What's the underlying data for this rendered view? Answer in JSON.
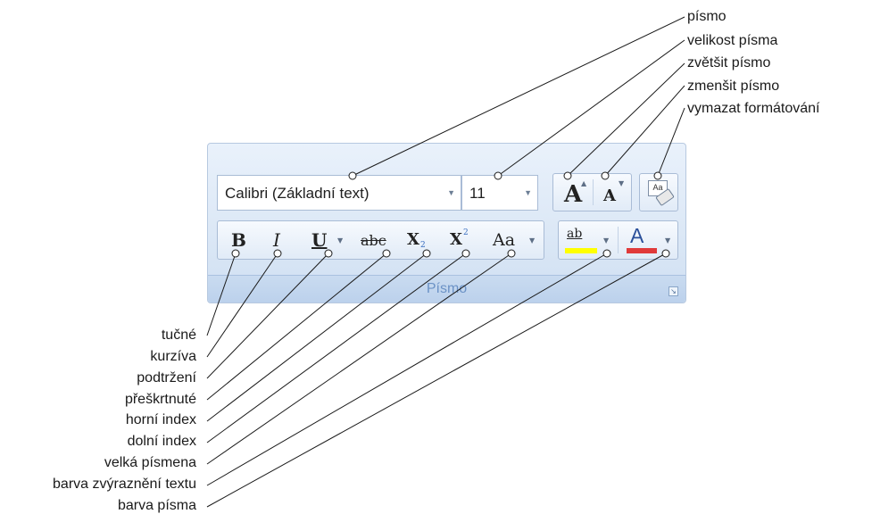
{
  "ribbon": {
    "group_title": "Písmo",
    "font_name": "Calibri (Základní text)",
    "font_size": "11",
    "icons": {
      "bold": "B",
      "italic": "I",
      "underline": "U",
      "strike": "abc",
      "subscript": "X",
      "superscript": "X",
      "change_case": "Aa",
      "grow": "A",
      "shrink": "A",
      "clear": "Aa",
      "font_color": "A",
      "highlight": "ab"
    },
    "colors": {
      "highlight": "#ffff00",
      "font_color": "#e03a3a",
      "group_title": "#6b92c6"
    }
  },
  "labels_top": [
    "písmo",
    "velikost písma",
    "zvětšit písmo",
    "zmenšit písmo",
    "vymazat formátování"
  ],
  "labels_left": [
    "tučné",
    "kurzíva",
    "podtržení",
    "přeškrtnuté",
    "horní index",
    "dolní index",
    "velká písmena",
    "barva zvýraznění textu",
    "barva písma"
  ]
}
